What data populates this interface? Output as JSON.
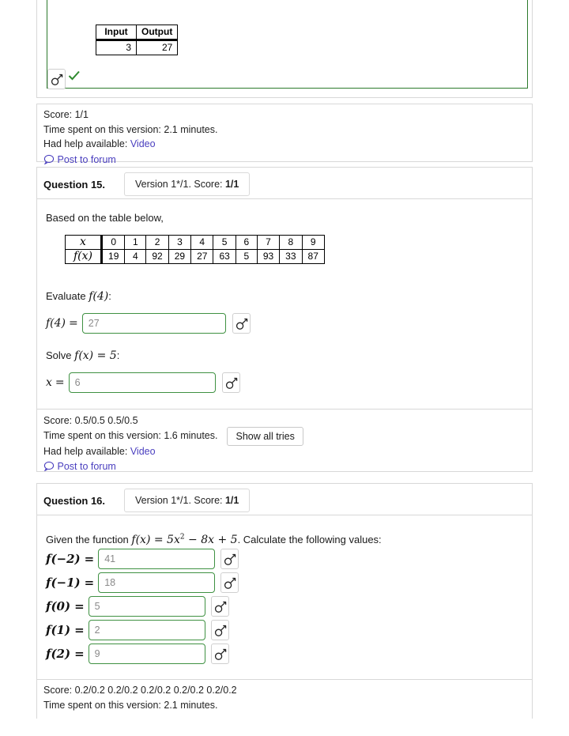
{
  "colors": {
    "answered_border": "#2c7a2c",
    "input_border": "#3f9142",
    "link": "#4a3fbf",
    "panel_border": "#d8d8d8",
    "check": "#2f8a2f"
  },
  "prev_question": {
    "table": {
      "headers": [
        "Input",
        "Output"
      ],
      "rows": [
        [
          "3",
          "27"
        ]
      ]
    },
    "key_icon": "key-icon",
    "correct_icon": "checkmark-icon"
  },
  "feedback_14": {
    "score": "Score: 1/1",
    "time": "Time spent on this version: 2.1 minutes.",
    "help_label": "Had help available:",
    "help_link": "Video",
    "forum_icon": "speech-bubble-icon",
    "forum_link": "Post to forum"
  },
  "question15": {
    "label": "Question 15.",
    "version_prefix": "Version 1*/1. Score: ",
    "version_score": "1/1",
    "prompt": "Based on the table below,",
    "table": {
      "row_labels": [
        "x",
        "f(x)"
      ],
      "x": [
        "0",
        "1",
        "2",
        "3",
        "4",
        "5",
        "6",
        "7",
        "8",
        "9"
      ],
      "fx": [
        "19",
        "4",
        "92",
        "29",
        "27",
        "63",
        "5",
        "93",
        "33",
        "87"
      ]
    },
    "part_a": {
      "prompt_pre": "Evaluate ",
      "prompt_math": "f(4)",
      "prompt_post": ":",
      "label_math": "f(4)",
      "equals": "=",
      "value": "27",
      "key_icon": "key-icon"
    },
    "part_b": {
      "prompt_pre": "Solve ",
      "prompt_math": "f(x) = 5",
      "prompt_post": ":",
      "label_math": "x",
      "equals": "=",
      "value": "6",
      "key_icon": "key-icon"
    },
    "feedback": {
      "score": "Score: 0.5/0.5 0.5/0.5",
      "time": "Time spent on this version: 1.6 minutes.",
      "show_all_tries": "Show all tries",
      "help_label": "Had help available:",
      "help_link": "Video",
      "forum_icon": "speech-bubble-icon",
      "forum_link": "Post to forum"
    }
  },
  "question16": {
    "label": "Question 16.",
    "version_prefix": "Version 1*/1. Score: ",
    "version_score": "1/1",
    "prompt_pre": "Given the function ",
    "prompt_math_f": "f(x) = 5x",
    "prompt_math_exp": "2",
    "prompt_math_tail": " − 8x + 5",
    "prompt_post": ". Calculate the following values:",
    "answers": [
      {
        "label": "f(−2)",
        "value": "41",
        "key_icon": "key-icon"
      },
      {
        "label": "f(−1)",
        "value": "18",
        "key_icon": "key-icon"
      },
      {
        "label": "f(0)",
        "value": "5",
        "key_icon": "key-icon"
      },
      {
        "label": "f(1)",
        "value": "2",
        "key_icon": "key-icon"
      },
      {
        "label": "f(2)",
        "value": "9",
        "key_icon": "key-icon"
      }
    ],
    "equals": "=",
    "feedback": {
      "score": "Score: 0.2/0.2 0.2/0.2 0.2/0.2 0.2/0.2 0.2/0.2",
      "time": "Time spent on this version: 2.1 minutes."
    }
  }
}
